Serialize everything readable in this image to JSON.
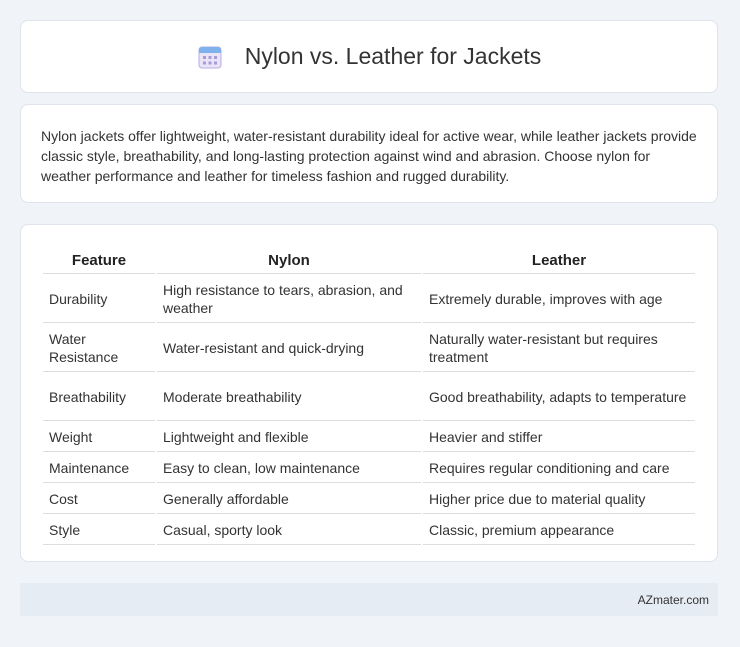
{
  "header": {
    "title": "Nylon vs. Leather for Jackets",
    "icon": "calendar-icon"
  },
  "intro": {
    "text": "Nylon jackets offer lightweight, water-resistant durability ideal for active wear, while leather jackets provide classic style, breathability, and long-lasting protection against wind and abrasion. Choose nylon for weather performance and leather for timeless fashion and rugged durability."
  },
  "table": {
    "headers": [
      "Feature",
      "Nylon",
      "Leather"
    ],
    "rows": [
      [
        "Durability",
        "High resistance to tears, abrasion, and weather",
        "Extremely durable, improves with age"
      ],
      [
        "Water Resistance",
        "Water-resistant and quick-drying",
        "Naturally water-resistant but requires treatment"
      ],
      [
        "Breathability",
        "Moderate breathability",
        "Good breathability, adapts to temperature"
      ],
      [
        "Weight",
        "Lightweight and flexible",
        "Heavier and stiffer"
      ],
      [
        "Maintenance",
        "Easy to clean, low maintenance",
        "Requires regular conditioning and care"
      ],
      [
        "Cost",
        "Generally affordable",
        "Higher price due to material quality"
      ],
      [
        "Style",
        "Casual, sporty look",
        "Classic, premium appearance"
      ]
    ]
  },
  "footer": {
    "text": "AZmater.com"
  }
}
